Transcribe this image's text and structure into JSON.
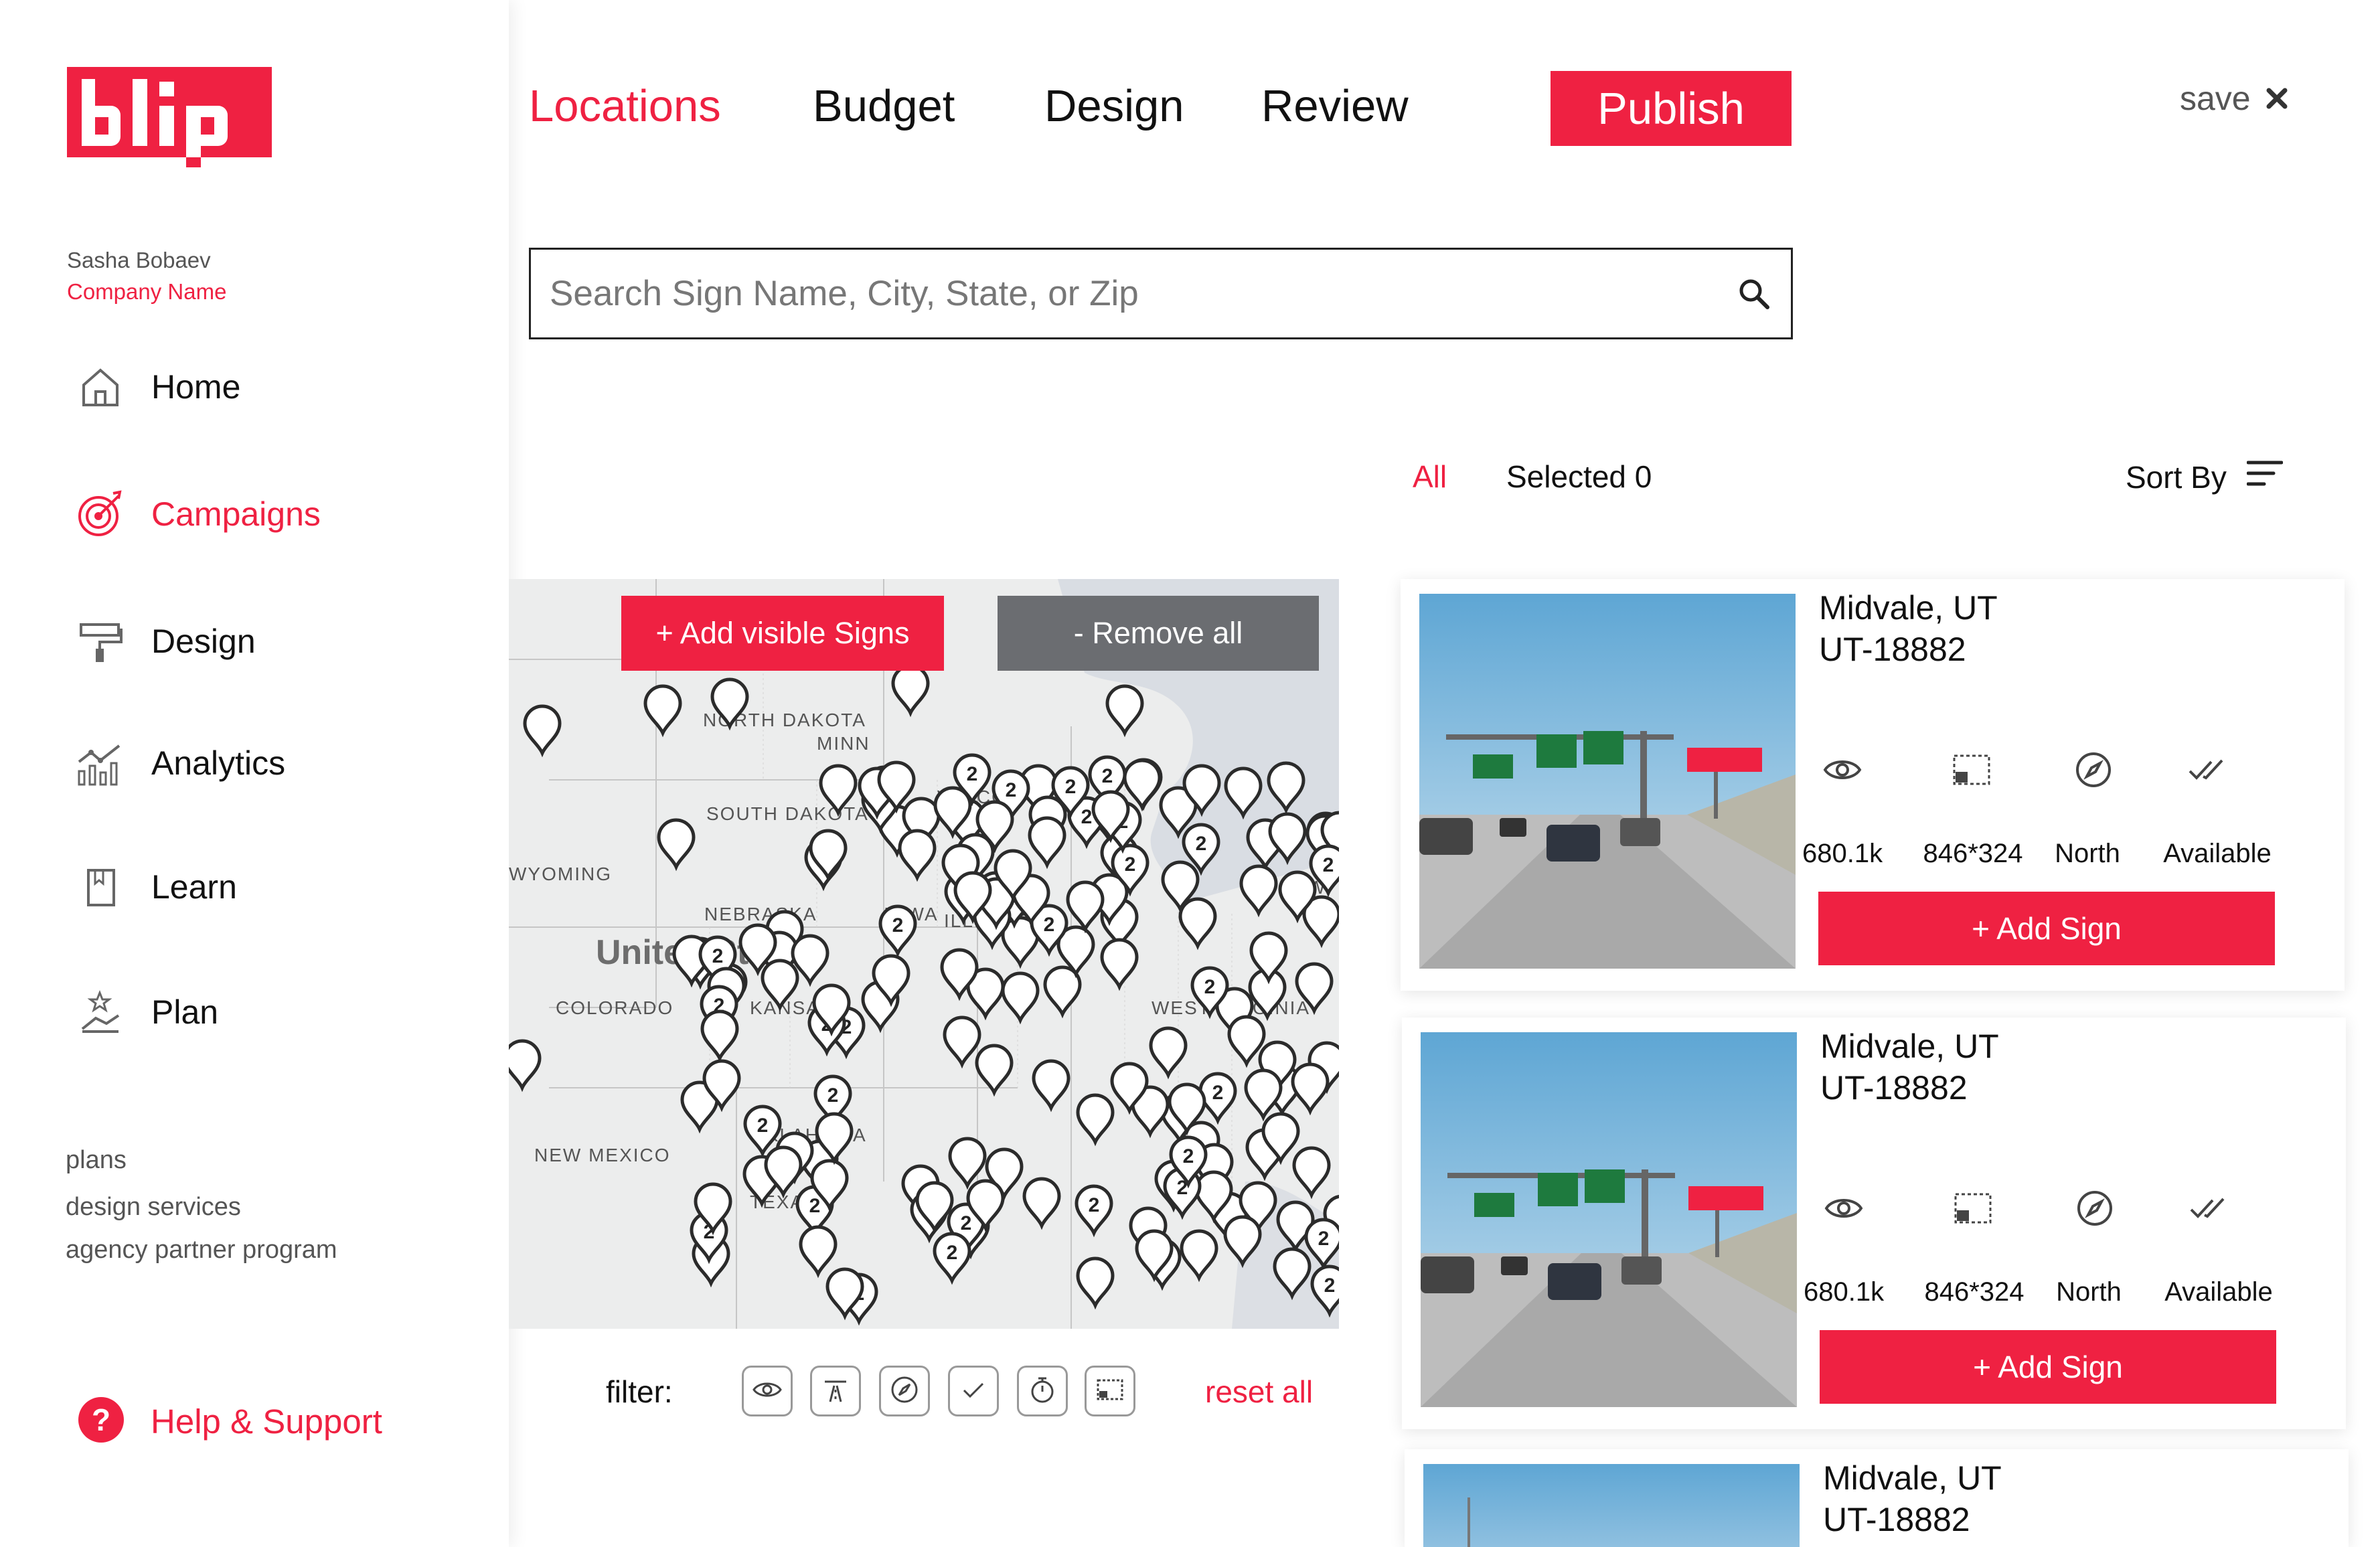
{
  "brand": {
    "logo_text": "blip",
    "color": "#ef2142"
  },
  "user": {
    "name": "Sasha Bobaev",
    "company": "Company Name"
  },
  "sidebar": {
    "nav": [
      {
        "label": "Home",
        "icon": "home-icon"
      },
      {
        "label": "Campaigns",
        "icon": "target-icon",
        "active": true
      },
      {
        "label": "Design",
        "icon": "paint-roller-icon"
      },
      {
        "label": "Analytics",
        "icon": "analytics-icon"
      },
      {
        "label": "Learn",
        "icon": "book-icon"
      },
      {
        "label": "Plan",
        "icon": "plan-icon"
      }
    ],
    "links": [
      "plans",
      "design services",
      "agency partner program"
    ],
    "help": "Help & Support"
  },
  "tabs": [
    {
      "label": "Locations",
      "active": true
    },
    {
      "label": "Budget"
    },
    {
      "label": "Design"
    },
    {
      "label": "Review"
    }
  ],
  "publish_label": "Publish",
  "save_label": "save",
  "search": {
    "placeholder": "Search Sign Name, City, State, or Zip"
  },
  "filters": {
    "all": "All",
    "selected": "Selected 0",
    "sort": "Sort By"
  },
  "map": {
    "add_visible": "+ Add visible Signs",
    "remove_all": "- Remove all",
    "labels": [
      "NORTH DAKOTA",
      "SOUTH DAKOTA",
      "NEBRASKA",
      "IOWA",
      "WYOMING",
      "COLORADO",
      "KANSAS",
      "NEW MEXICO",
      "OKLAHOMA",
      "TEXAS",
      "MINN",
      "WISCO",
      "ILLINOIS",
      "WEST VIRGINIA",
      "NEW",
      "United States"
    ],
    "cluster_count": "2"
  },
  "toolbar": {
    "filter_label": "filter:",
    "icons": [
      "eye-icon",
      "road-icon",
      "compass-icon",
      "check-icon",
      "timer-icon",
      "dimension-icon"
    ],
    "reset": "reset all"
  },
  "cards": [
    {
      "city": "Midvale, UT",
      "id": "UT-18882",
      "views": "680.1k",
      "size": "846*324",
      "facing": "North",
      "status": "Available",
      "button": "+ Add Sign"
    },
    {
      "city": "Midvale, UT",
      "id": "UT-18882",
      "views": "680.1k",
      "size": "846*324",
      "facing": "North",
      "status": "Available",
      "button": "+ Add Sign"
    },
    {
      "city": "Midvale, UT",
      "id": "UT-18882"
    }
  ]
}
